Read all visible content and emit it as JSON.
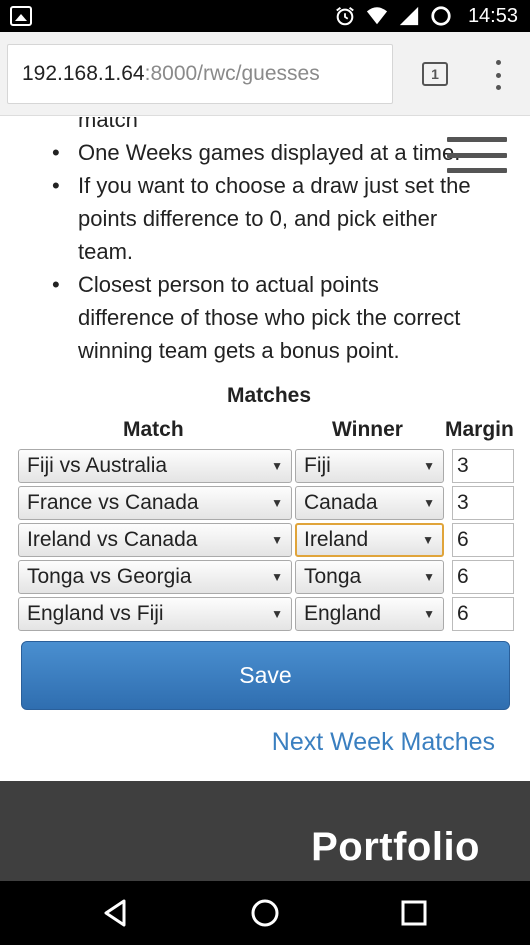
{
  "status_bar": {
    "time": "14:53",
    "icons": [
      "image-notification-icon",
      "alarm-icon",
      "wifi-icon",
      "signal-icon",
      "battery-icon"
    ]
  },
  "browser": {
    "url_host": "192.168.1.64",
    "url_path": ":8000/rwc/guesses",
    "tab_count": "1"
  },
  "rules": {
    "partial_line": "match",
    "items": [
      [
        "One Weeks games displayed at a time."
      ],
      [
        "If you want to choose a draw just set the",
        "points difference to 0, and pick either",
        "team."
      ],
      [
        "Closest person to actual points",
        "difference of those who pick the correct",
        "winning team gets a bonus point."
      ]
    ]
  },
  "table": {
    "caption": "Matches",
    "headers": {
      "match": "Match",
      "winner": "Winner",
      "margin": "Margin"
    },
    "rows": [
      {
        "match": "Fiji vs Australia",
        "winner": "Fiji",
        "margin": "3"
      },
      {
        "match": "France vs Canada",
        "winner": "Canada",
        "margin": "3"
      },
      {
        "match": "Ireland vs Canada",
        "winner": "Ireland",
        "margin": "6"
      },
      {
        "match": "Tonga vs Georgia",
        "winner": "Tonga",
        "margin": "6"
      },
      {
        "match": "England vs Fiji",
        "winner": "England",
        "margin": "6"
      }
    ]
  },
  "actions": {
    "save_label": "Save",
    "next_week_label": "Next Week Matches"
  },
  "footer": {
    "title": "Portfolio"
  },
  "colors": {
    "primary_button": "#337ab7",
    "link": "#3a7fc0",
    "focus": "#e0a43a",
    "footer_bg": "#3f3f3f"
  }
}
